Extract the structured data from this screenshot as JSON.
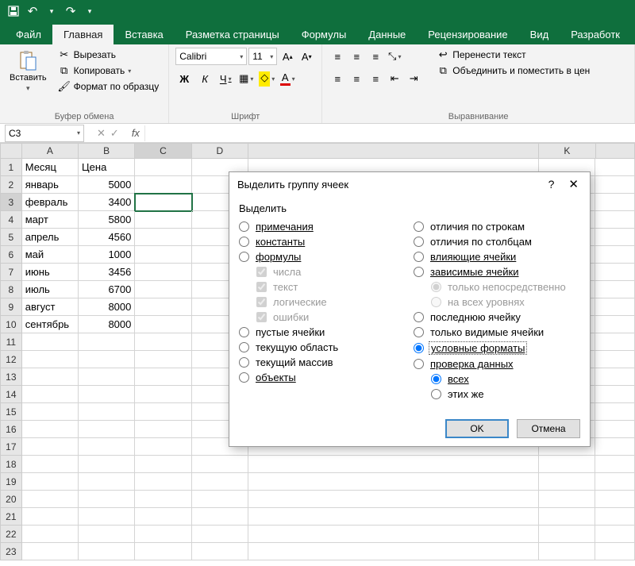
{
  "titlebar": {
    "save_icon": "save",
    "undo_icon": "↶",
    "redo_icon": "↷"
  },
  "tabs": {
    "file": "Файл",
    "home": "Главная",
    "insert": "Вставка",
    "layout": "Разметка страницы",
    "formulas": "Формулы",
    "data": "Данные",
    "review": "Рецензирование",
    "view": "Вид",
    "dev": "Разработк"
  },
  "ribbon": {
    "paste": "Вставить",
    "cut": "Вырезать",
    "copy": "Копировать",
    "format_painter": "Формат по образцу",
    "clipboard_group": "Буфер обмена",
    "font_name": "Calibri",
    "font_size": "11",
    "bold": "Ж",
    "italic": "К",
    "underline": "Ч",
    "font_group": "Шрифт",
    "align_group": "Выравнивание",
    "wrap": "Перенести текст",
    "merge": "Объединить и поместить в цен"
  },
  "namebox": "C3",
  "columns": [
    "A",
    "B",
    "C",
    "D",
    "",
    "",
    "",
    "",
    "",
    "K",
    ""
  ],
  "sheet": {
    "header_a": "Месяц",
    "header_b": "Цена",
    "rows": [
      {
        "a": "январь",
        "b": "5000"
      },
      {
        "a": "февраль",
        "b": "3400"
      },
      {
        "a": "март",
        "b": "5800"
      },
      {
        "a": "апрель",
        "b": "4560"
      },
      {
        "a": "май",
        "b": "1000"
      },
      {
        "a": "июнь",
        "b": "3456"
      },
      {
        "a": "июль",
        "b": "6700"
      },
      {
        "a": "август",
        "b": "8000"
      },
      {
        "a": "сентябрь",
        "b": "8000"
      }
    ]
  },
  "dialog": {
    "title": "Выделить группу ячеек",
    "subtitle": "Выделить",
    "comments": "примечания",
    "constants": "константы",
    "formulas": "формулы",
    "numbers": "числа",
    "text": "текст",
    "logicals": "логические",
    "errors": "ошибки",
    "blanks": "пустые ячейки",
    "current_region": "текущую область",
    "current_array": "текущий массив",
    "objects": "объекты",
    "row_diffs": "отличия по строкам",
    "col_diffs": "отличия по столбцам",
    "precedents": "влияющие ячейки",
    "dependents": "зависимые ячейки",
    "direct_only": "только непосредственно",
    "all_levels": "на всех уровнях",
    "last_cell": "последнюю ячейку",
    "visible_only": "только видимые ячейки",
    "cond_formats": "условные форматы",
    "data_validation": "проверка данных",
    "all": "всех",
    "same": "этих же",
    "ok": "OK",
    "cancel": "Отмена"
  }
}
